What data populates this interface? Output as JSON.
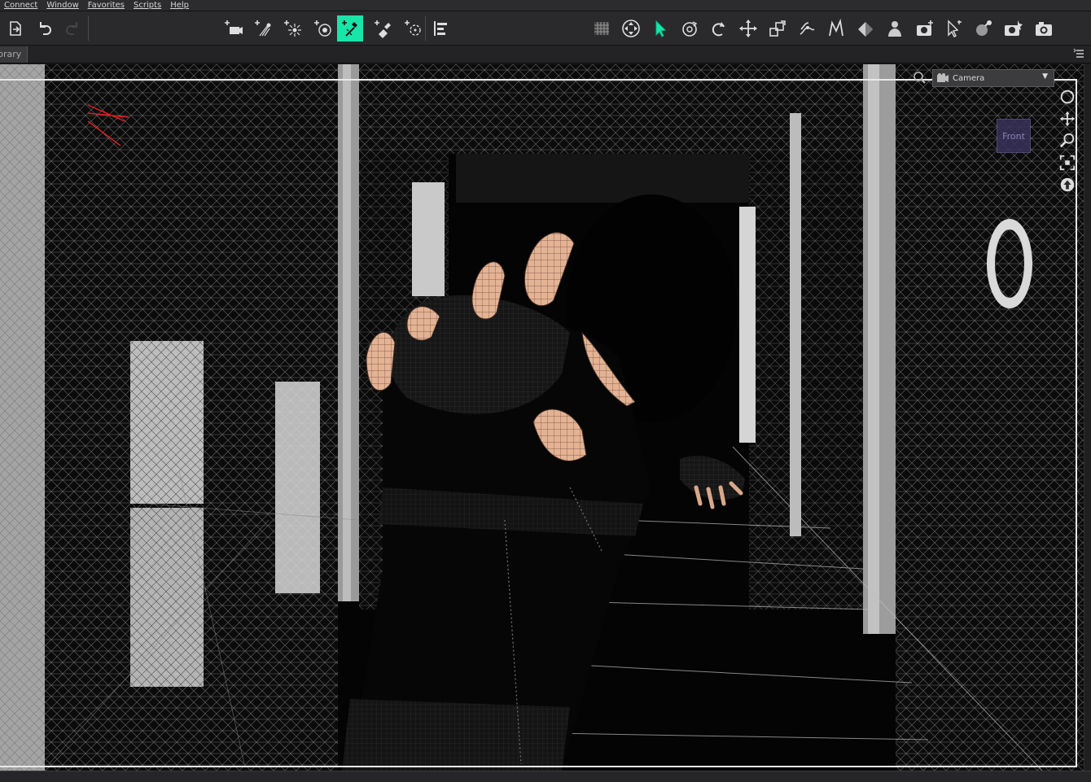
{
  "menu": {
    "items": [
      "Connect",
      "Window",
      "Favorites",
      "Scripts",
      "Help"
    ]
  },
  "toolbar": {
    "left": [
      {
        "icon": "save-scene-icon"
      },
      {
        "icon": "undo-icon"
      },
      {
        "icon": "redo-icon"
      }
    ],
    "center": [
      {
        "icon": "create-camera-icon"
      },
      {
        "icon": "create-spotlight-icon"
      },
      {
        "icon": "create-point-light-icon"
      },
      {
        "icon": "create-distant-light-icon"
      },
      {
        "icon": "create-linear-point-light-icon",
        "active": true
      },
      {
        "icon": "create-area-light-icon"
      },
      {
        "icon": "create-null-icon"
      },
      {
        "icon": "align-icon"
      }
    ],
    "right": [
      {
        "icon": "viewport-grid-icon"
      },
      {
        "icon": "universal-tool-icon"
      },
      {
        "icon": "node-selection-icon"
      },
      {
        "icon": "rotate-view-icon"
      },
      {
        "icon": "rotate-tool-icon"
      },
      {
        "icon": "translate-tool-icon"
      },
      {
        "icon": "scale-tool-icon"
      },
      {
        "icon": "joint-editor-icon"
      },
      {
        "icon": "node-weight-map-icon"
      },
      {
        "icon": "surface-selection-icon"
      },
      {
        "icon": "figure-setup-icon"
      },
      {
        "icon": "render-settings-camera-icon"
      },
      {
        "icon": "spot-render-icon"
      },
      {
        "icon": "iray-preview-icon"
      },
      {
        "icon": "render-icon"
      },
      {
        "icon": "render-image-icon"
      }
    ],
    "active_color": "#19e5a9"
  },
  "tabs": {
    "library_label": "brary"
  },
  "viewport": {
    "camera_label": "Camera",
    "cube_label": "Front",
    "nav_icons": [
      "orbit-icon",
      "pan-icon",
      "zoom-icon",
      "frame-icon",
      "reset-view-icon"
    ]
  }
}
